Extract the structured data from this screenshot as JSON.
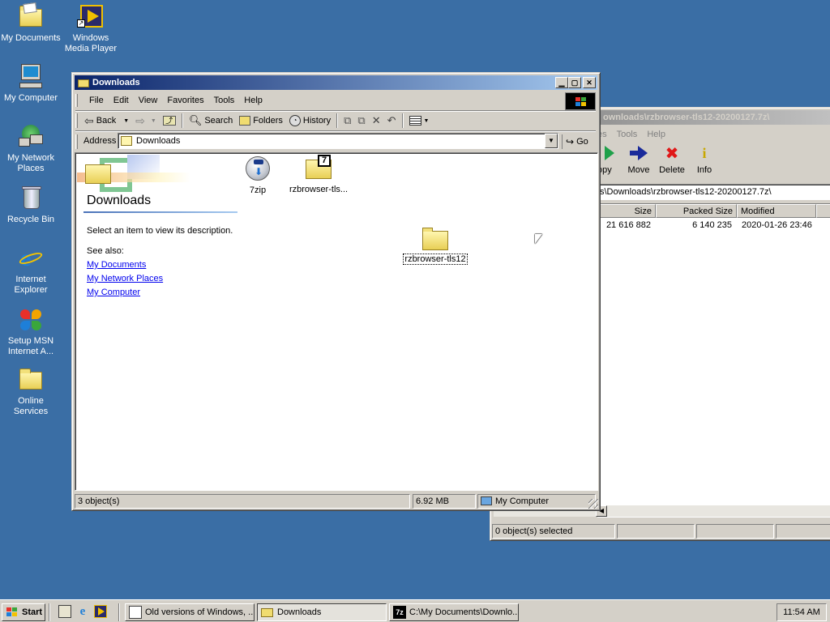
{
  "desktop": {
    "icons": [
      {
        "label": "My Documents"
      },
      {
        "label": "Windows Media Player"
      },
      {
        "label": "My Computer"
      },
      {
        "label": "My Network Places"
      },
      {
        "label": "Recycle Bin"
      },
      {
        "label": "Internet Explorer"
      },
      {
        "label": "Setup MSN Internet A..."
      },
      {
        "label": "Online Services"
      }
    ]
  },
  "explorer": {
    "title": "Downloads",
    "menu": [
      "File",
      "Edit",
      "View",
      "Favorites",
      "Tools",
      "Help"
    ],
    "toolbar": {
      "back": "Back",
      "search": "Search",
      "folders": "Folders",
      "history": "History"
    },
    "address_label": "Address",
    "address_value": "Downloads",
    "go_label": "Go",
    "left_panel": {
      "folder_title": "Downloads",
      "description": "Select an item to view its description.",
      "see_also": "See also:",
      "links": [
        "My Documents",
        "My Network Places",
        "My Computer"
      ]
    },
    "files": [
      {
        "name": "7zip",
        "icon": "installer-icon"
      },
      {
        "name": "rzbrowser-tls...",
        "icon": "7z-archive-icon"
      },
      {
        "name": "rzbrowser-tls12",
        "icon": "folder-icon"
      }
    ],
    "status": {
      "objects": "3 object(s)",
      "size": "6.92 MB",
      "zone": "My Computer"
    }
  },
  "sevenzip": {
    "title": "ownloads\\rzbrowser-tls12-20200127.7z\\",
    "menu": [
      "es",
      "Tools",
      "Help"
    ],
    "toolbar": {
      "copy": "opy",
      "move": "Move",
      "delete": "Delete",
      "info": "Info"
    },
    "path": "s\\Downloads\\rzbrowser-tls12-20200127.7z\\",
    "columns": [
      "Size",
      "Packed Size",
      "Modified"
    ],
    "row": {
      "size": "21 616 882",
      "packed": "6 140 235",
      "modified": "2020-01-26 23:46"
    },
    "status": "0 object(s) selected"
  },
  "taskbar": {
    "start": "Start",
    "tasks": [
      {
        "label": "Old versions of Windows, ..."
      },
      {
        "label": "Downloads"
      },
      {
        "label": "C:\\My Documents\\Downlo..."
      }
    ],
    "clock": "11:54 AM"
  }
}
